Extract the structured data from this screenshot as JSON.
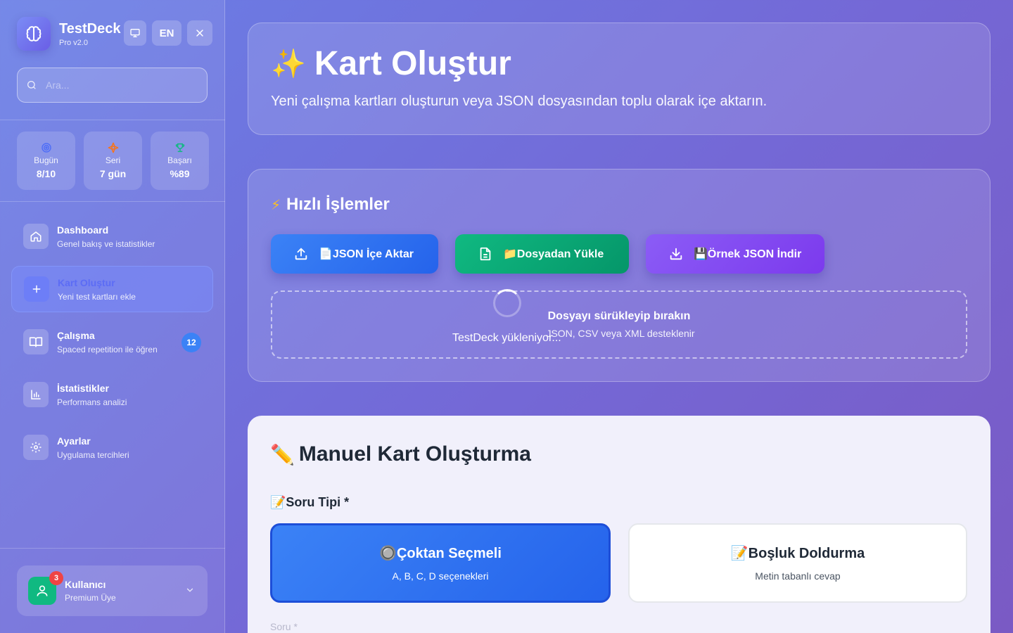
{
  "brand": {
    "title": "TestDeck",
    "version": "Pro v2.0",
    "icon": "brain-icon"
  },
  "top_actions": {
    "display_icon": "monitor-icon",
    "language": "EN",
    "close_icon": "close-icon"
  },
  "search": {
    "placeholder": "Ara..."
  },
  "stats": [
    {
      "icon": "target-icon",
      "label": "Bugün",
      "value": "8/10",
      "color": "#4f6ef7"
    },
    {
      "icon": "flame-icon",
      "label": "Seri",
      "value": "7 gün",
      "color": "#f97316"
    },
    {
      "icon": "trophy-icon",
      "label": "Başarı",
      "value": "%89",
      "color": "#10b981"
    }
  ],
  "nav": [
    {
      "title": "Dashboard",
      "subtitle": "Genel bakış ve istatistikler",
      "icon": "home-icon"
    },
    {
      "title": "Kart Oluştur",
      "subtitle": "Yeni test kartları ekle",
      "icon": "plus-icon",
      "active": true
    },
    {
      "title": "Çalışma",
      "subtitle": "Spaced repetition ile öğren",
      "icon": "book-icon",
      "badge": "12"
    },
    {
      "title": "İstatistikler",
      "subtitle": "Performans analizi",
      "icon": "chart-icon"
    },
    {
      "title": "Ayarlar",
      "subtitle": "Uygulama tercihleri",
      "icon": "gear-icon"
    }
  ],
  "user": {
    "name": "Kullanıcı",
    "role": "Premium Üye",
    "notifications": "3"
  },
  "hero": {
    "emoji": "✨",
    "title": "Kart Oluştur",
    "subtitle": "Yeni çalışma kartları oluşturun veya JSON dosyasından toplu olarak içe aktarın."
  },
  "quick_actions": {
    "emoji": "⚡",
    "title": "Hızlı İşlemler",
    "buttons": [
      {
        "label": "📄JSON İçe Aktar",
        "icon": "upload-icon",
        "color": "#3b82f6"
      },
      {
        "label": "📁Dosyadan Yükle",
        "icon": "file-icon",
        "color": "#10b981"
      },
      {
        "label": "💾Örnek JSON İndir",
        "icon": "download-icon",
        "color": "#8b5cf6"
      }
    ],
    "dropzone": {
      "title": "Dosyayı sürükleyip bırakın",
      "subtitle": "JSON, CSV veya XML desteklenir",
      "loading": "TestDeck yükleniyor..."
    }
  },
  "manual": {
    "emoji": "✏️",
    "title": "Manuel Kart Oluşturma",
    "question_type_label": "📝Soru Tipi *",
    "types": [
      {
        "title": "🔘Çoktan Seçmeli",
        "subtitle": "A, B, C, D seçenekleri",
        "selected": true
      },
      {
        "title": "📝Boşluk Doldurma",
        "subtitle": "Metin tabanlı cevap",
        "selected": false
      }
    ],
    "question_label": "Soru *"
  }
}
